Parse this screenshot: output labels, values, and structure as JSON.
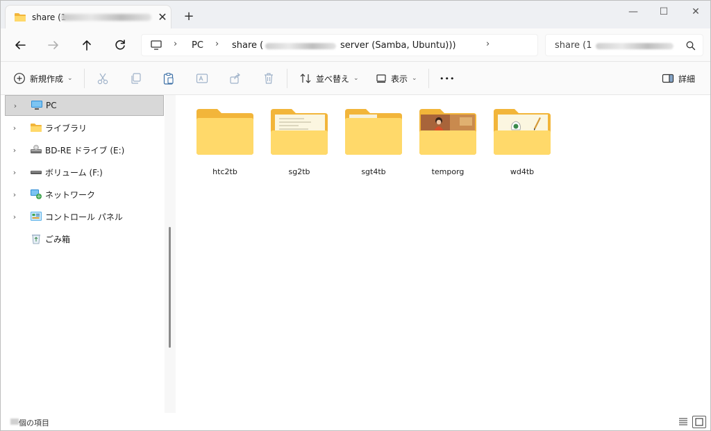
{
  "window": {
    "tab_title": "share (1",
    "new_tab_symbol": "+",
    "close_tab_symbol": "✕",
    "minimize_symbol": "—",
    "maximize_symbol": "☐",
    "close_symbol": "✕"
  },
  "address": {
    "crumb_pc": "PC",
    "crumb_share_prefix": "share (",
    "crumb_share_suffix": "server (Samba, Ubuntu)))",
    "sep": "›",
    "search_placeholder": "share (1"
  },
  "toolbar": {
    "new_label": "新規作成",
    "sort_label": "並べ替え",
    "view_label": "表示",
    "more_label": "•••",
    "details_label": "詳細"
  },
  "sidebar": {
    "items": [
      {
        "label": "PC",
        "icon": "monitor-icon",
        "expandable": true,
        "selected": true
      },
      {
        "label": "ライブラリ",
        "icon": "folder-icon",
        "expandable": true
      },
      {
        "label": "BD-RE ドライブ (E:)",
        "icon": "optical-drive-icon",
        "expandable": true
      },
      {
        "label": "ボリューム (F:)",
        "icon": "drive-icon",
        "expandable": true
      },
      {
        "label": "ネットワーク",
        "icon": "network-icon",
        "expandable": true
      },
      {
        "label": "コントロール パネル",
        "icon": "control-panel-icon",
        "expandable": true
      },
      {
        "label": "ごみ箱",
        "icon": "recycle-bin-icon",
        "expandable": false
      }
    ]
  },
  "content": {
    "folders": [
      {
        "name": "htc2tb",
        "preview": "empty"
      },
      {
        "name": "sg2tb",
        "preview": "document"
      },
      {
        "name": "sgt4tb",
        "preview": "empty-paper"
      },
      {
        "name": "temporg",
        "preview": "photo"
      },
      {
        "name": "wd4tb",
        "preview": "pencil"
      }
    ]
  },
  "status": {
    "items_text": "個の項目"
  },
  "colors": {
    "folder_back": "#F2B53A",
    "folder_front": "#FFD96A",
    "selection": "#D8D8D8",
    "accent": "#0067C0"
  }
}
